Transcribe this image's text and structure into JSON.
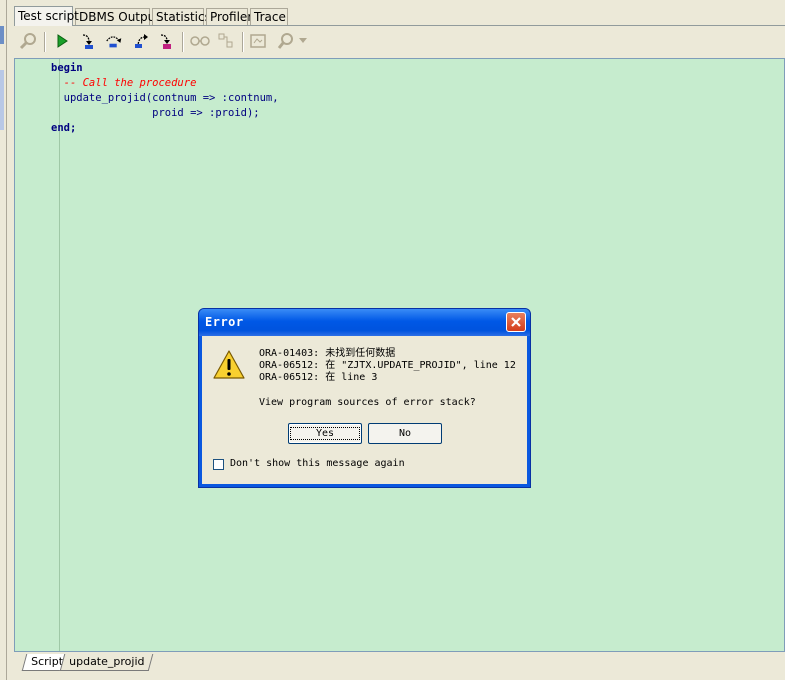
{
  "tabs": [
    {
      "label": "Test script"
    },
    {
      "label": "DBMS Output"
    },
    {
      "label": "Statistics"
    },
    {
      "label": "Profiler"
    },
    {
      "label": "Trace"
    }
  ],
  "toolbar": {
    "icons": [
      "debug-settings-icon",
      "execute-icon",
      "step-into-icon",
      "step-over-icon",
      "step-out-icon",
      "run-to-exception-icon",
      "watch-icon",
      "breakpoints-icon",
      "show-output-icon",
      "find-icon"
    ]
  },
  "editor": {
    "lines": [
      {
        "type": "kw",
        "text": "begin"
      },
      {
        "type": "cm",
        "text": "  -- Call the procedure"
      },
      {
        "type": "txt",
        "text": "  update_projid(contnum => :contnum,"
      },
      {
        "type": "txt",
        "text": "                proid => :proid);"
      },
      {
        "type": "kw",
        "text": "end;"
      }
    ]
  },
  "bottom_tabs": [
    {
      "label": "Script"
    },
    {
      "label": "update_projid"
    }
  ],
  "dialog": {
    "title": "Error",
    "message_lines": [
      "ORA-01403: 未找到任何数据",
      "ORA-06512: 在 \"ZJTX.UPDATE_PROJID\", line 12",
      "ORA-06512: 在 line 3"
    ],
    "question": "View program sources of error stack?",
    "yes_label": "Yes",
    "no_label": "No",
    "checkbox_label": "Don't show this message again",
    "checkbox_checked": false
  },
  "colors": {
    "editor_bg": "#c6ecce",
    "keyword": "#000080",
    "comment": "#ff0000",
    "titlebar": "#0058e6"
  }
}
